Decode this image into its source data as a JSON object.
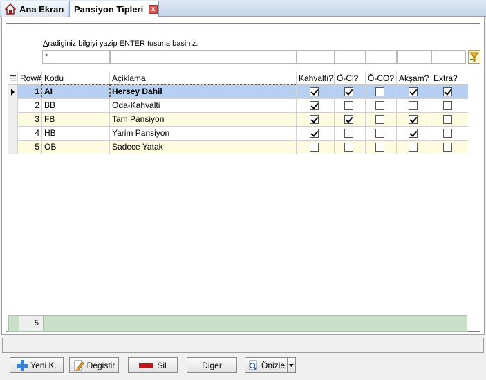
{
  "tabs": {
    "home": "Ana Ekran",
    "active": "Pansiyon Tipleri",
    "close": "x"
  },
  "search": {
    "caption_first": "A",
    "caption_rest": "radiginiz bilgiyi yazip ENTER tusuna basiniz.",
    "value": "*"
  },
  "grid": {
    "headers": [
      "Row#",
      "Kodu",
      "Açiklama",
      "Kahvaltı?",
      "Ö-Cl?",
      "Ö-CO?",
      "Akşam?",
      "Extra?"
    ],
    "rows": [
      {
        "row": "1",
        "kodu": "AI",
        "aciklama": "Hersey Dahil",
        "checks": [
          true,
          true,
          false,
          true,
          true
        ]
      },
      {
        "row": "2",
        "kodu": "BB",
        "aciklama": "Oda-Kahvalti",
        "checks": [
          true,
          false,
          false,
          false,
          false
        ]
      },
      {
        "row": "3",
        "kodu": "FB",
        "aciklama": "Tam Pansiyon",
        "checks": [
          true,
          true,
          false,
          true,
          false
        ]
      },
      {
        "row": "4",
        "kodu": "HB",
        "aciklama": "Yarim Pansiyon",
        "checks": [
          true,
          false,
          false,
          true,
          false
        ]
      },
      {
        "row": "5",
        "kodu": "OB",
        "aciklama": "Sadece Yatak",
        "checks": [
          false,
          false,
          false,
          false,
          false
        ]
      }
    ],
    "footer_count": "5"
  },
  "buttons": {
    "new": "Yeni K.",
    "edit": "Degistir",
    "delete": "Sil",
    "other": "Diger",
    "preview": "Önizle"
  },
  "colors": {
    "selected_row": "#b7cff0",
    "alt_row": "#fdfbe0",
    "footer": "#c9dfc8"
  }
}
